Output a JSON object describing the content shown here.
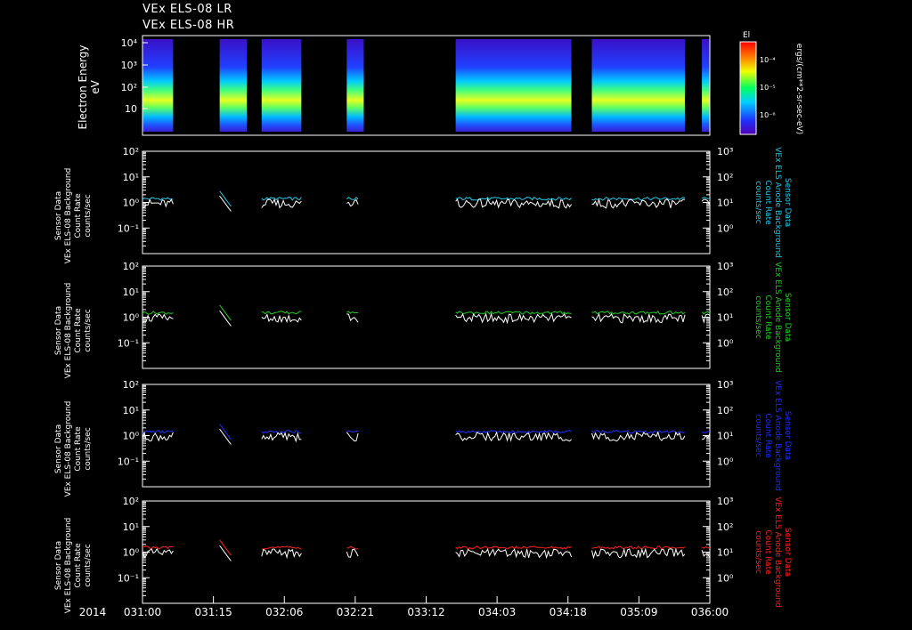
{
  "header": {
    "line1": "VEx ELS-08 LR",
    "line2": "VEx ELS-08 HR"
  },
  "colors": {
    "axis": "#ffffff",
    "cyan": "#22c8e6",
    "green": "#22cc22",
    "blue": "#1f2fff",
    "red": "#ff2020",
    "white_trace": "#ffffff"
  },
  "colorbar": {
    "label": "El",
    "ticks": [
      "10⁻⁴",
      "10⁻⁵",
      "10⁻⁶"
    ],
    "units": "ergs/(cm**2-sr-sec-eV)"
  },
  "time_axis": {
    "year": "2014",
    "ticks": [
      "031:00",
      "031:15",
      "032:06",
      "032:21",
      "033:12",
      "034:03",
      "034:18",
      "035:09",
      "036:00"
    ]
  },
  "chart_data": [
    {
      "type": "heatmap",
      "ylabel": "Electron Energy",
      "yunit": "eV",
      "yscale": "log",
      "ytick_labels": [
        "10⁴",
        "10³",
        "10²",
        "10"
      ],
      "data_segments": [
        [
          0.0,
          0.27
        ],
        [
          0.68,
          0.92
        ],
        [
          1.05,
          1.4
        ],
        [
          1.8,
          1.95
        ],
        [
          2.76,
          3.78
        ],
        [
          3.96,
          4.78
        ],
        [
          4.93,
          5.0
        ]
      ]
    },
    {
      "type": "line",
      "ylabel": "Sensor Data VEx ELS-08 Background Count Rate counts/sec",
      "ylabel_right": "Sensor Data VEx ELS Anode Background Count Rate counts/sec",
      "left_ticks": [
        "10²",
        "10¹",
        "10⁰",
        "10⁻¹"
      ],
      "right_ticks": [
        "10³",
        "10²",
        "10¹",
        "10⁰"
      ],
      "yscale": "log",
      "series": [
        {
          "color": "cyan",
          "level": 1.4
        },
        {
          "color": "white",
          "level": 0.9
        }
      ]
    },
    {
      "type": "line",
      "ylabel": "Sensor Data VEx ELS-08 Background Count Rate counts/sec",
      "ylabel_right": "Sensor Data VEx ELS Anode Background Count Rate counts/sec",
      "left_ticks": [
        "10²",
        "10¹",
        "10⁰",
        "10⁻¹"
      ],
      "right_ticks": [
        "10³",
        "10²",
        "10¹",
        "10⁰"
      ],
      "yscale": "log",
      "series": [
        {
          "color": "green",
          "level": 1.5
        },
        {
          "color": "white",
          "level": 0.9
        }
      ]
    },
    {
      "type": "line",
      "ylabel": "Sensor Data VEx ELS-08 Background Count Rate counts/sec",
      "ylabel_right": "Sensor Data VEx ELS Anode Background Count Rate counts/sec",
      "left_ticks": [
        "10²",
        "10¹",
        "10⁰",
        "10⁻¹"
      ],
      "right_ticks": [
        "10³",
        "10²",
        "10¹",
        "10⁰"
      ],
      "yscale": "log",
      "series": [
        {
          "color": "blue",
          "level": 1.4
        },
        {
          "color": "white",
          "level": 0.9
        }
      ]
    },
    {
      "type": "line",
      "ylabel": "Sensor Data VEx ELS-08 Background Count Rate counts/sec",
      "ylabel_right": "Sensor Data VEx ELS Anode Background Count Rate counts/sec",
      "left_ticks": [
        "10²",
        "10¹",
        "10⁰",
        "10⁻¹"
      ],
      "right_ticks": [
        "10³",
        "10²",
        "10¹",
        "10⁰"
      ],
      "yscale": "log",
      "series": [
        {
          "color": "red",
          "level": 1.5
        },
        {
          "color": "white",
          "level": 0.9
        }
      ]
    }
  ]
}
